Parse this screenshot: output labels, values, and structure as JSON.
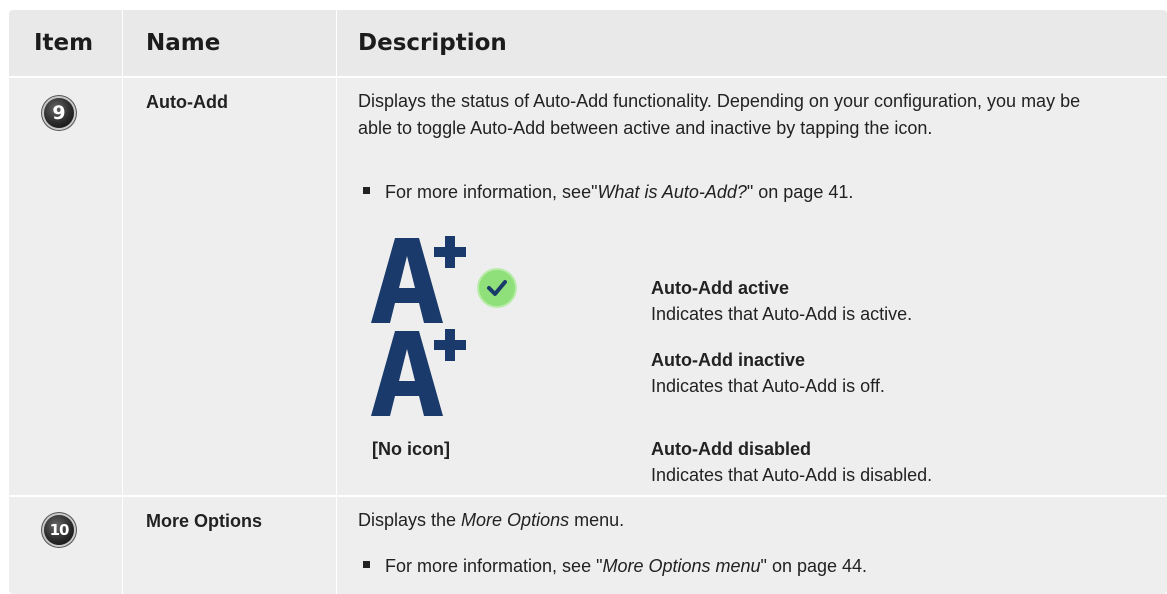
{
  "header": {
    "col_item": "Item",
    "col_name": "Name",
    "col_description": "Description"
  },
  "rows": [
    {
      "badge": "9",
      "name": "Auto-Add",
      "description": "Displays the status of Auto-Add functionality. Depending on your configuration, you may be able to toggle Auto-Add between active and inactive by tapping the icon.",
      "bullet": {
        "prefix": "For more information, see\"",
        "link": "What is Auto-Add?",
        "suffix": "\" on page 41."
      },
      "statuses": [
        {
          "icon": "auto-add-active-icon",
          "title": "Auto-Add active",
          "text": "Indicates that Auto-Add is active."
        },
        {
          "icon": "auto-add-inactive-icon",
          "title": "Auto-Add inactive",
          "text": "Indicates that Auto-Add is off."
        },
        {
          "icon_label": "[No icon]",
          "title": "Auto-Add disabled",
          "text": "Indicates that Auto-Add is disabled."
        }
      ]
    },
    {
      "badge": "10",
      "name": "More Options",
      "description": {
        "prefix": "Displays the ",
        "emph": "More Options",
        "suffix": " menu."
      },
      "bullet": {
        "prefix": "For more information, see \"",
        "link": "More Options menu",
        "suffix": "\" on page 44."
      }
    }
  ],
  "colors": {
    "icon_navy": "#1a3a6b",
    "check_green": "#8fe07a",
    "check_mark": "#1a3a6b",
    "table_bg": "#eeeeee"
  }
}
